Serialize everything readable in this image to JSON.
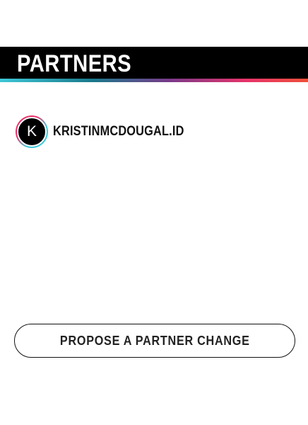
{
  "header": {
    "title": "PARTNERS"
  },
  "accent_gradient": [
    "#3ec8d8",
    "#1a7a8c",
    "#7a3a8a",
    "#e8336a",
    "#f0503a"
  ],
  "partners": [
    {
      "avatar_letter": "K",
      "name": "KRISTINMCDOUGAL.ID",
      "ring_colors": [
        "#e8336a",
        "#3ec8d8"
      ]
    }
  ],
  "actions": {
    "propose_label": "PROPOSE A PARTNER CHANGE"
  }
}
